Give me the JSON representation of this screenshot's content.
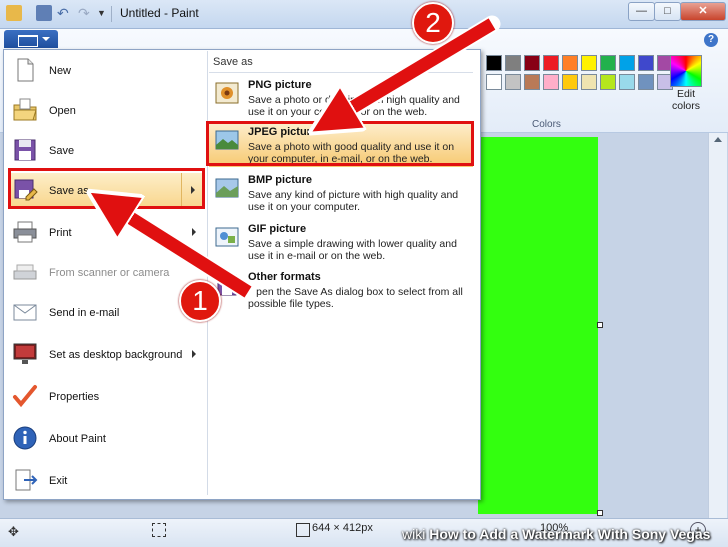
{
  "window": {
    "title": "Untitled - Paint"
  },
  "ribbon": {
    "colors_label": "Colors",
    "edit_colors_label": "Edit colors",
    "swatches_row1": [
      "#000000",
      "#7f7f7f",
      "#880015",
      "#ed1c24",
      "#ff7f27",
      "#fff200",
      "#22b14c",
      "#00a2e8",
      "#3f48cc",
      "#a349a4"
    ],
    "swatches_row2": [
      "#ffffff",
      "#c3c3c3",
      "#b97a57",
      "#ffaec9",
      "#ffc90e",
      "#efe4b0",
      "#b5e61d",
      "#99d9ea",
      "#7092be",
      "#c8bfe7"
    ]
  },
  "file_menu": {
    "items": [
      {
        "label": "New",
        "icon": "new-document-icon"
      },
      {
        "label": "Open",
        "icon": "open-folder-icon"
      },
      {
        "label": "Save",
        "icon": "floppy-disk-icon"
      },
      {
        "label": "Save as",
        "icon": "save-as-icon"
      },
      {
        "label": "Print",
        "icon": "printer-icon"
      },
      {
        "label": "From scanner or camera",
        "icon": "scanner-icon"
      },
      {
        "label": "Send in e-mail",
        "icon": "email-icon"
      },
      {
        "label": "Set as desktop background",
        "icon": "desktop-background-icon"
      },
      {
        "label": "Properties",
        "icon": "checkmark-icon"
      },
      {
        "label": "About Paint",
        "icon": "info-icon"
      },
      {
        "label": "Exit",
        "icon": "exit-door-icon"
      }
    ]
  },
  "save_as": {
    "header": "Save as",
    "options": [
      {
        "title": "PNG picture",
        "desc": "Save a photo or drawing with high quality and use it on your computer or on the web."
      },
      {
        "title": "JPEG picture",
        "desc": "Save a photo with good quality and use it on your computer, in e-mail, or on the web."
      },
      {
        "title": "BMP picture",
        "desc": "Save any kind of picture with high quality and use it on your computer."
      },
      {
        "title": "GIF picture",
        "desc": "Save a simple drawing with lower quality and use it in e-mail or on the web."
      },
      {
        "title": "Other formats",
        "desc": "Open the Save As dialog box to select from all possible file types."
      }
    ]
  },
  "canvas": {
    "color": "#33ff0f"
  },
  "status": {
    "dimensions": "644 × 412px",
    "zoom": "100%"
  },
  "annotations": {
    "step1": "1",
    "step2": "2",
    "color": "#e01010"
  },
  "watermark": {
    "brand": "wiki",
    "text": "How to Add a Watermark With Sony Vegas"
  }
}
